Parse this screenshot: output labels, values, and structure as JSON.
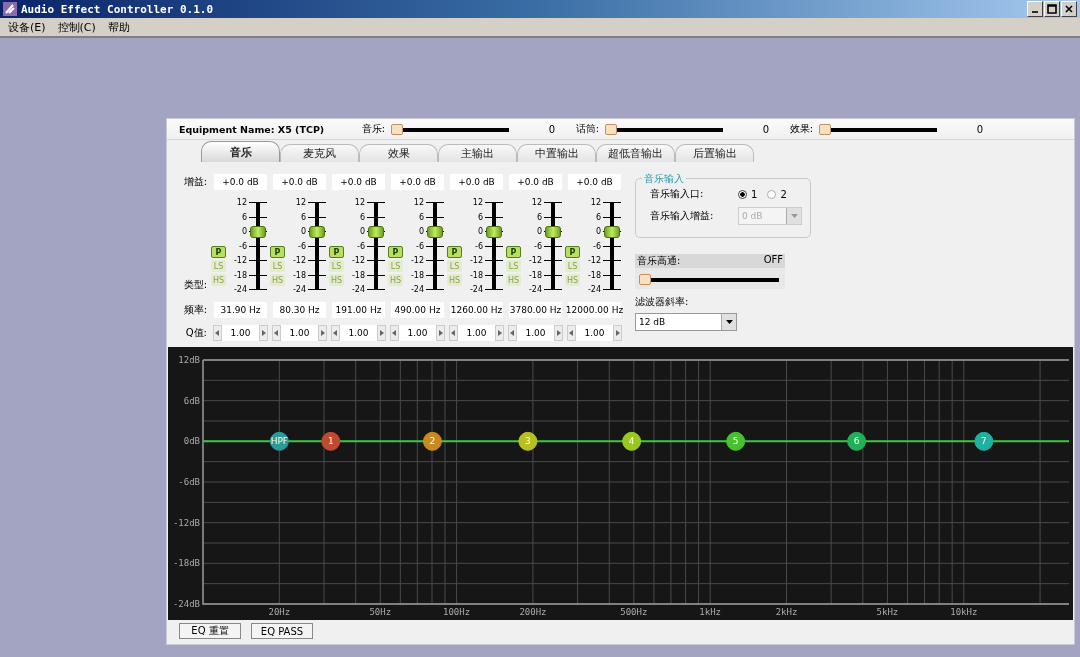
{
  "window": {
    "title": "Audio Effect Controller 0.1.0"
  },
  "menu": [
    "设备(E)",
    "控制(C)",
    "帮助"
  ],
  "top_bar": {
    "equipment": "Equipment Name: X5 (TCP)",
    "sliders": [
      {
        "label": "音乐:",
        "level": 0,
        "value": "0"
      },
      {
        "label": "话筒:",
        "level": 0,
        "value": "0"
      },
      {
        "label": "效果:",
        "level": 0,
        "value": "0"
      }
    ]
  },
  "tabs": [
    {
      "label": "音乐",
      "selected": true
    },
    {
      "label": "麦克风",
      "selected": false
    },
    {
      "label": "效果",
      "selected": false
    },
    {
      "label": "主输出",
      "selected": false
    },
    {
      "label": "中置输出",
      "selected": false
    },
    {
      "label": "超低音输出",
      "selected": false
    },
    {
      "label": "后置输出",
      "selected": false
    }
  ],
  "row_labels": {
    "gain": "增益:",
    "type": "类型:",
    "frequency": "频率:",
    "q": "Q值:"
  },
  "channels": [
    {
      "gain": "+0.0 dB",
      "level": 0.667,
      "scale": [
        "12",
        "6",
        "0",
        "-6",
        "-12",
        "-18",
        "-24"
      ],
      "types": [
        {
          "label": "P",
          "selected": true
        },
        {
          "label": "LS",
          "selected": false
        },
        {
          "label": "HS",
          "selected": false
        }
      ],
      "frequency": "31.90 Hz",
      "q": "1.00"
    },
    {
      "gain": "+0.0 dB",
      "level": 0.667,
      "scale": [
        "12",
        "6",
        "0",
        "-6",
        "-12",
        "-18",
        "-24"
      ],
      "types": [
        {
          "label": "P",
          "selected": true
        },
        {
          "label": "LS",
          "selected": false
        },
        {
          "label": "HS",
          "selected": false
        }
      ],
      "frequency": "80.30 Hz",
      "q": "1.00"
    },
    {
      "gain": "+0.0 dB",
      "level": 0.667,
      "scale": [
        "12",
        "6",
        "0",
        "-6",
        "-12",
        "-18",
        "-24"
      ],
      "types": [
        {
          "label": "P",
          "selected": true
        },
        {
          "label": "LS",
          "selected": false
        },
        {
          "label": "HS",
          "selected": false
        }
      ],
      "frequency": "191.00 Hz",
      "q": "1.00"
    },
    {
      "gain": "+0.0 dB",
      "level": 0.667,
      "scale": [
        "12",
        "6",
        "0",
        "-6",
        "-12",
        "-18",
        "-24"
      ],
      "types": [
        {
          "label": "P",
          "selected": true
        },
        {
          "label": "LS",
          "selected": false
        },
        {
          "label": "HS",
          "selected": false
        }
      ],
      "frequency": "490.00 Hz",
      "q": "1.00"
    },
    {
      "gain": "+0.0 dB",
      "level": 0.667,
      "scale": [
        "12",
        "6",
        "0",
        "-6",
        "-12",
        "-18",
        "-24"
      ],
      "types": [
        {
          "label": "P",
          "selected": true
        },
        {
          "label": "LS",
          "selected": false
        },
        {
          "label": "HS",
          "selected": false
        }
      ],
      "frequency": "1260.00 Hz",
      "q": "1.00"
    },
    {
      "gain": "+0.0 dB",
      "level": 0.667,
      "scale": [
        "12",
        "6",
        "0",
        "-6",
        "-12",
        "-18",
        "-24"
      ],
      "types": [
        {
          "label": "P",
          "selected": true
        },
        {
          "label": "LS",
          "selected": false
        },
        {
          "label": "HS",
          "selected": false
        }
      ],
      "frequency": "3780.00 Hz",
      "q": "1.00"
    },
    {
      "gain": "+0.0 dB",
      "level": 0.667,
      "scale": [
        "12",
        "6",
        "0",
        "-6",
        "-12",
        "-18",
        "-24"
      ],
      "types": [
        {
          "label": "P",
          "selected": true
        },
        {
          "label": "LS",
          "selected": false
        },
        {
          "label": "HS",
          "selected": false
        }
      ],
      "frequency": "12000.00 Hz",
      "q": "1.00"
    }
  ],
  "music_input": {
    "title": "音乐输入",
    "port_label": "音乐输入口:",
    "ports": [
      {
        "label": "1",
        "selected": true
      },
      {
        "label": "2",
        "selected": false
      }
    ],
    "gain_label": "音乐输入增益:",
    "gain": {
      "value": "0 dB",
      "disabled": true
    }
  },
  "high_pass": {
    "label": "音乐高通:",
    "value": "OFF",
    "level": 0
  },
  "filter_slope": {
    "label": "滤波器斜率:",
    "value": "12 dB"
  },
  "eq_graph": {
    "y_labels": [
      "12dB",
      "6dB",
      "0dB",
      "-6dB",
      "-12dB",
      "-18dB",
      "-24dB"
    ],
    "x_labels": [
      "20Hz",
      "50Hz",
      "100Hz",
      "200Hz",
      "500Hz",
      "1kHz",
      "2kHz",
      "5kHz",
      "10kHz"
    ],
    "nodes": [
      {
        "label": "HPF",
        "color": "#2a9a9a"
      },
      {
        "label": "1",
        "color": "#c04a30"
      },
      {
        "label": "2",
        "color": "#c88a20"
      },
      {
        "label": "3",
        "color": "#b8c020"
      },
      {
        "label": "4",
        "color": "#98c820"
      },
      {
        "label": "5",
        "color": "#48c030"
      },
      {
        "label": "6",
        "color": "#20b058"
      },
      {
        "label": "7",
        "color": "#20b0a0"
      }
    ]
  },
  "buttons": [
    "EQ 重置",
    "EQ PASS"
  ]
}
